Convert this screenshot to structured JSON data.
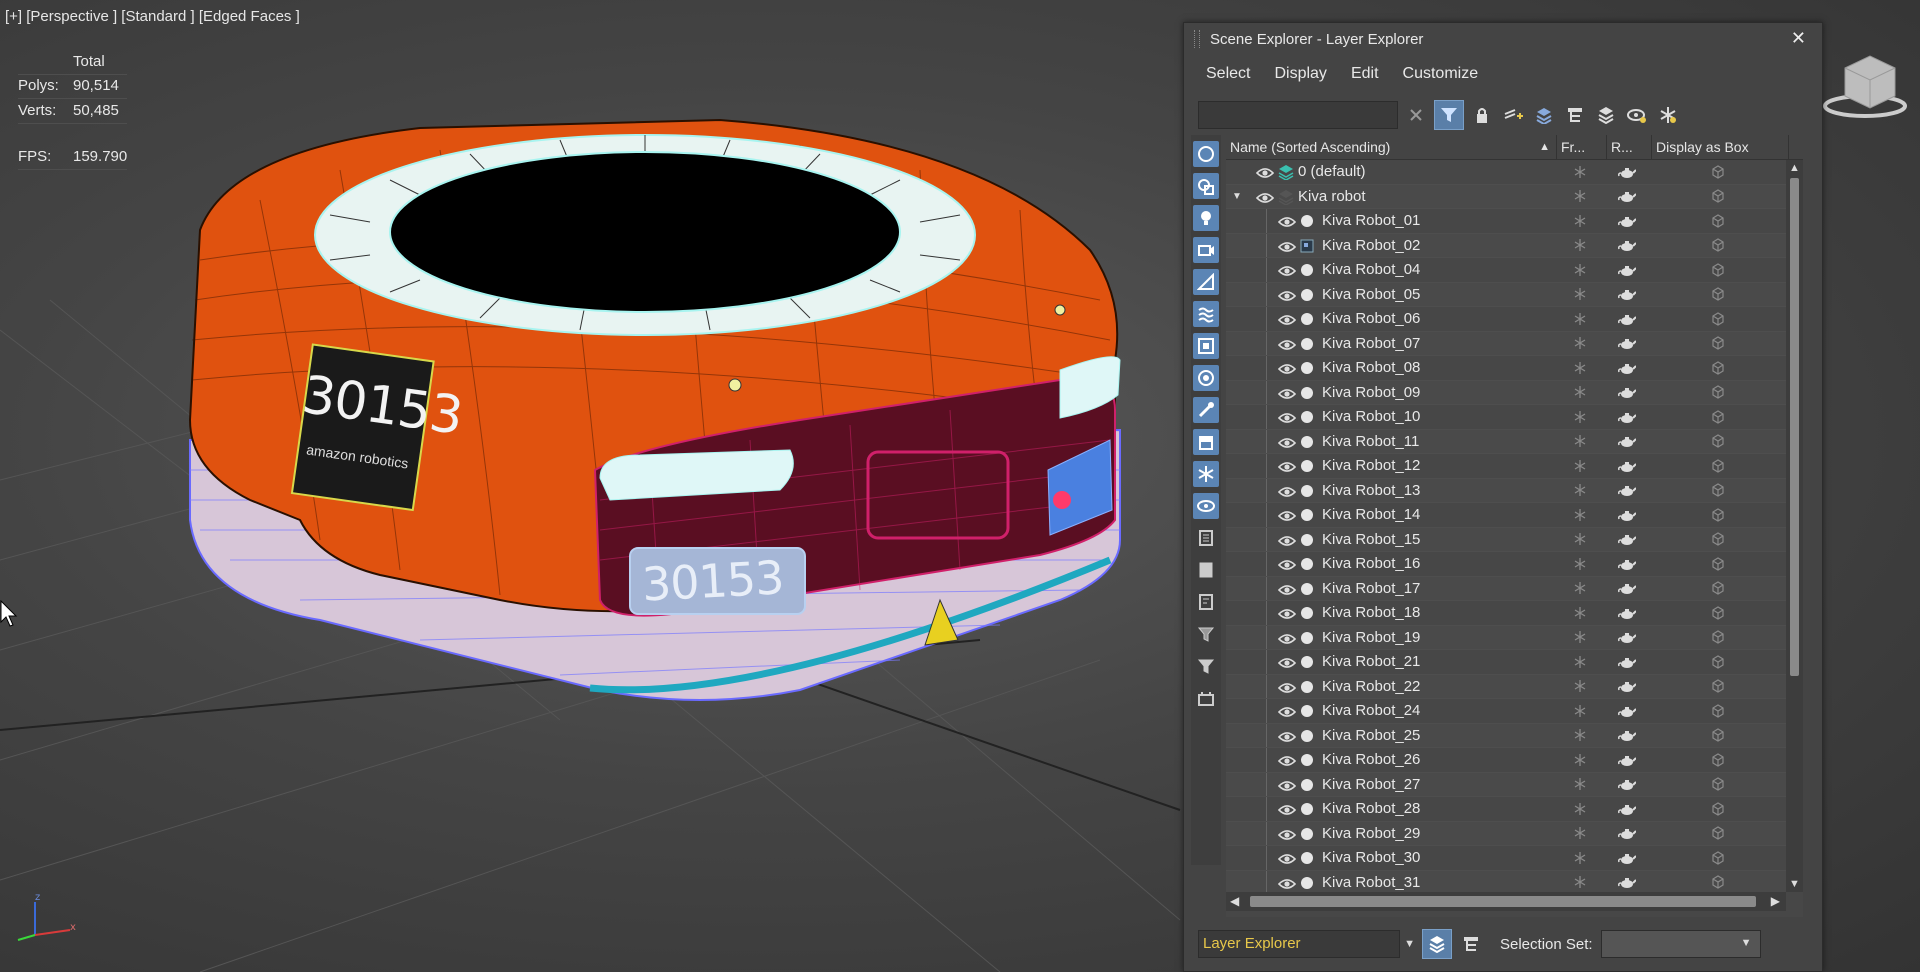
{
  "viewport": {
    "label": "[+] [Perspective ] [Standard ] [Edged Faces ]",
    "stats": {
      "header": "Total",
      "polys_label": "Polys:",
      "polys_value": "90,514",
      "verts_label": "Verts:",
      "verts_value": "50,485",
      "fps_label": "FPS:",
      "fps_value": "159.790"
    },
    "plate_text": "30153",
    "plate_subtext": "amazon robotics",
    "front_plate_text": "30153",
    "colors": {
      "body": "#e0520f",
      "wire_pink": "#d0206a",
      "wire_blue": "#6a6aff",
      "wire_cyan": "#a8f4f0"
    }
  },
  "explorer": {
    "title": "Scene Explorer - Layer Explorer",
    "menu": [
      "Select",
      "Display",
      "Edit",
      "Customize"
    ],
    "search": {
      "value": "",
      "placeholder": ""
    },
    "columns": {
      "name": "Name (Sorted Ascending)",
      "freeze": "Fr...",
      "render": "R...",
      "box": "Display as Box"
    },
    "rows": [
      {
        "label": "0 (default)",
        "level": 0,
        "type": "layer"
      },
      {
        "label": "Kiva robot",
        "level": 0,
        "type": "layer-open"
      },
      {
        "label": "Kiva Robot_01",
        "level": 1,
        "type": "object"
      },
      {
        "label": "Kiva Robot_02",
        "level": 1,
        "type": "object-sel"
      },
      {
        "label": "Kiva Robot_04",
        "level": 1,
        "type": "object"
      },
      {
        "label": "Kiva Robot_05",
        "level": 1,
        "type": "object"
      },
      {
        "label": "Kiva Robot_06",
        "level": 1,
        "type": "object"
      },
      {
        "label": "Kiva Robot_07",
        "level": 1,
        "type": "object"
      },
      {
        "label": "Kiva Robot_08",
        "level": 1,
        "type": "object"
      },
      {
        "label": "Kiva Robot_09",
        "level": 1,
        "type": "object"
      },
      {
        "label": "Kiva Robot_10",
        "level": 1,
        "type": "object"
      },
      {
        "label": "Kiva Robot_11",
        "level": 1,
        "type": "object"
      },
      {
        "label": "Kiva Robot_12",
        "level": 1,
        "type": "object"
      },
      {
        "label": "Kiva Robot_13",
        "level": 1,
        "type": "object"
      },
      {
        "label": "Kiva Robot_14",
        "level": 1,
        "type": "object"
      },
      {
        "label": "Kiva Robot_15",
        "level": 1,
        "type": "object"
      },
      {
        "label": "Kiva Robot_16",
        "level": 1,
        "type": "object"
      },
      {
        "label": "Kiva Robot_17",
        "level": 1,
        "type": "object"
      },
      {
        "label": "Kiva Robot_18",
        "level": 1,
        "type": "object"
      },
      {
        "label": "Kiva Robot_19",
        "level": 1,
        "type": "object"
      },
      {
        "label": "Kiva Robot_21",
        "level": 1,
        "type": "object"
      },
      {
        "label": "Kiva Robot_22",
        "level": 1,
        "type": "object"
      },
      {
        "label": "Kiva Robot_24",
        "level": 1,
        "type": "object"
      },
      {
        "label": "Kiva Robot_25",
        "level": 1,
        "type": "object"
      },
      {
        "label": "Kiva Robot_26",
        "level": 1,
        "type": "object"
      },
      {
        "label": "Kiva Robot_27",
        "level": 1,
        "type": "object"
      },
      {
        "label": "Kiva Robot_28",
        "level": 1,
        "type": "object"
      },
      {
        "label": "Kiva Robot_29",
        "level": 1,
        "type": "object"
      },
      {
        "label": "Kiva Robot_30",
        "level": 1,
        "type": "object"
      },
      {
        "label": "Kiva Robot_31",
        "level": 1,
        "type": "object"
      }
    ],
    "bottom": {
      "layer_mode": "Layer Explorer",
      "selection_set_label": "Selection Set:",
      "selection_set_value": ""
    },
    "colors": {
      "accent": "#5a7fa8",
      "layer_text": "#e8c84a",
      "panel": "#444444"
    }
  }
}
